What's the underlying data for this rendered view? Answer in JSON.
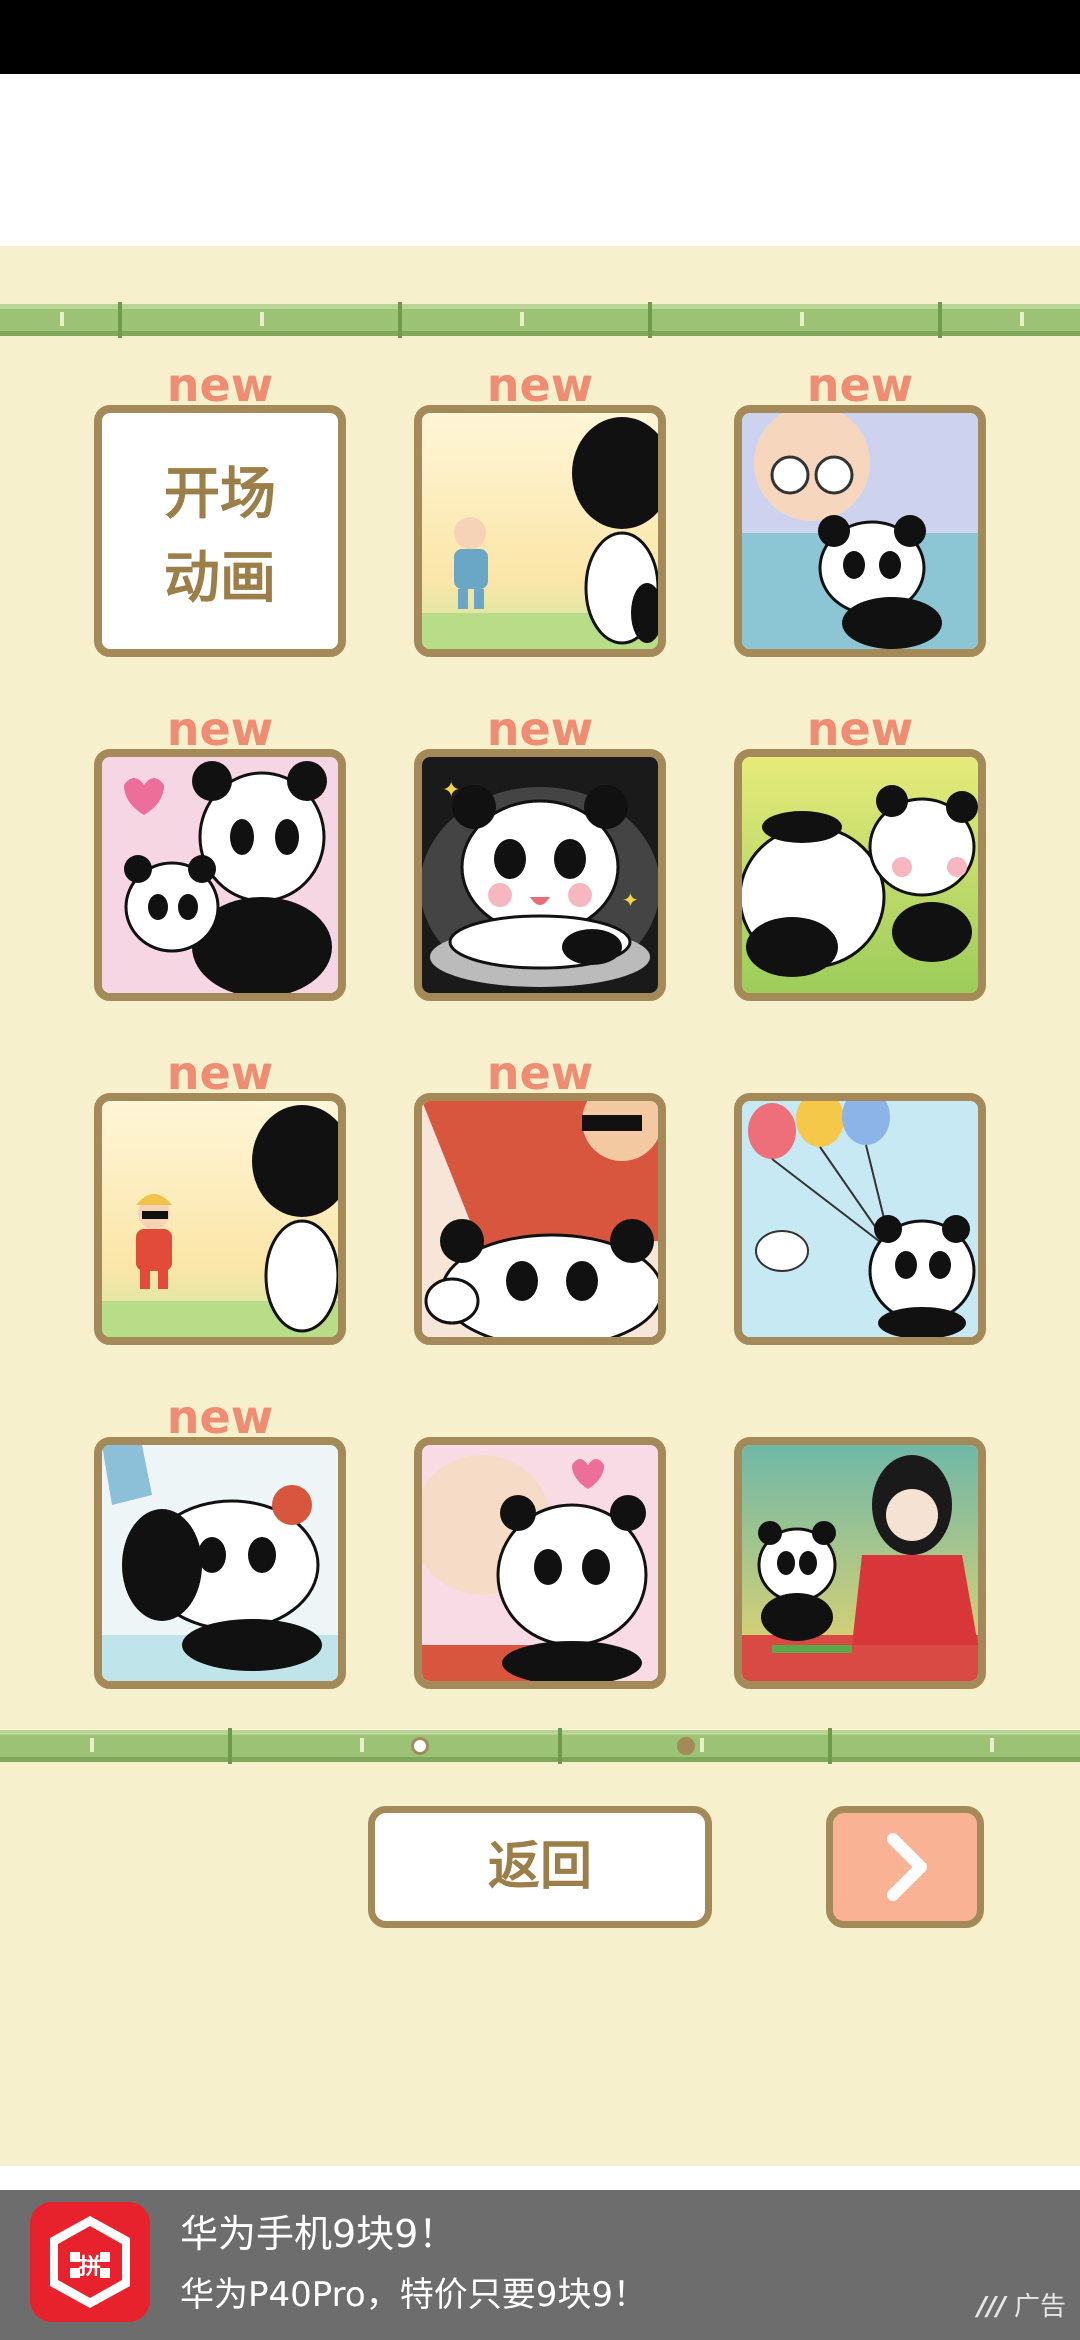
{
  "gallery": {
    "new_label": "new",
    "opening_line1": "开场",
    "opening_line2": "动画"
  },
  "tiles": [
    {
      "name": "opening-animation",
      "new": true
    },
    {
      "name": "grandpa-waving",
      "new": true
    },
    {
      "name": "grandpa-hugging-panda",
      "new": true
    },
    {
      "name": "panda-mother-and-cub",
      "new": true
    },
    {
      "name": "panda-in-pot",
      "new": true
    },
    {
      "name": "pandas-lying",
      "new": true
    },
    {
      "name": "boy-in-red-waving",
      "new": true
    },
    {
      "name": "man-with-pandas",
      "new": true
    },
    {
      "name": "panda-balloons",
      "new": false
    },
    {
      "name": "panda-sweating",
      "new": true
    },
    {
      "name": "panda-with-baby",
      "new": false
    },
    {
      "name": "panda-with-kimono-girl",
      "new": false
    }
  ],
  "pager": {
    "current_page": 1,
    "total_pages": 2
  },
  "buttons": {
    "back_label": "返回",
    "next_icon": "chevron-right-icon"
  },
  "ad": {
    "title": "华为手机9块9！",
    "subtitle": "华为P40Pro，特价只要9块9！",
    "tag": "广告",
    "logo_text": "拼"
  },
  "colors": {
    "background": "#f7f0cd",
    "tile_border": "#a48a58",
    "new_label": "#ef8c72",
    "bamboo": "#9cc275",
    "next_button": "#f9b394",
    "ad_bar": "#6d6d6d"
  }
}
